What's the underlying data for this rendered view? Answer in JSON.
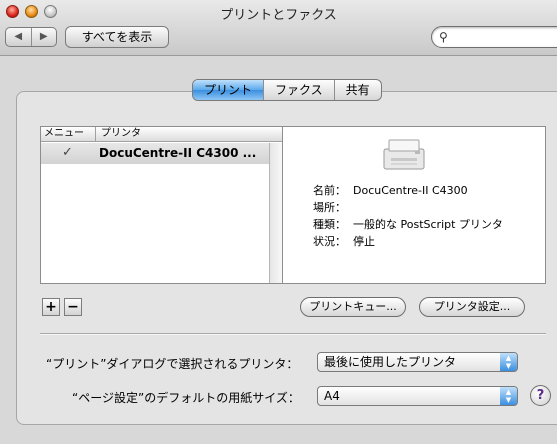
{
  "window": {
    "title": "プリントとファクス"
  },
  "toolbar": {
    "back_icon": "◀",
    "forward_icon": "▶",
    "show_all_label": "すべてを表示",
    "search_value": "",
    "search_placeholder": ""
  },
  "tabs": [
    {
      "label": "プリント",
      "active": true
    },
    {
      "label": "ファクス",
      "active": false
    },
    {
      "label": "共有",
      "active": false
    }
  ],
  "printer_list": {
    "columns": [
      "メニュー",
      "プリンタ"
    ],
    "rows": [
      {
        "in_menu": true,
        "checkmark": "✓",
        "name": "DocuCentre-II C4300 ..."
      }
    ]
  },
  "printer_info": {
    "fields": [
      {
        "label": "名前：",
        "value": "DocuCentre-II C4300"
      },
      {
        "label": "場所：",
        "value": ""
      },
      {
        "label": "種類：",
        "value": "一般的な PostScript プリンタ"
      },
      {
        "label": "状況：",
        "value": "停止"
      }
    ]
  },
  "list_buttons": {
    "add_label": "+",
    "remove_label": "−"
  },
  "actions": {
    "print_queue_label": "プリントキュー...",
    "printer_setup_label": "プリンタ設定..."
  },
  "settings": {
    "selected_printer_label": "“プリント”ダイアログで選択されるプリンタ：",
    "selected_printer_value": "最後に使用したプリンタ",
    "paper_size_label": "“ページ設定”のデフォルトの用紙サイズ：",
    "paper_size_value": "A4"
  },
  "help": {
    "label": "?"
  },
  "colors": {
    "accent": "#3b8fe0"
  }
}
